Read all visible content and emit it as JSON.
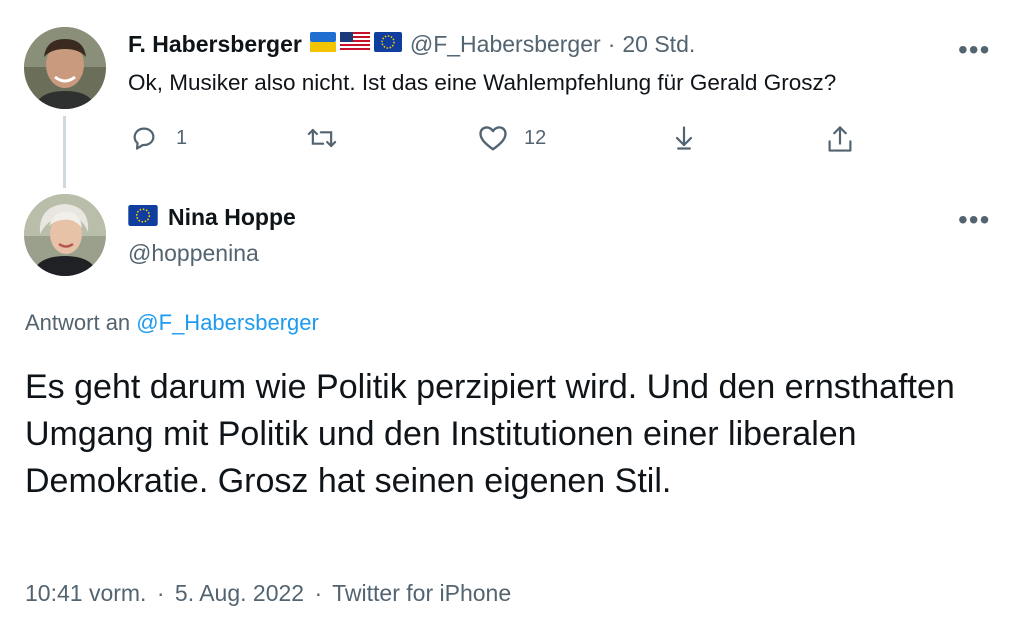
{
  "parent_tweet": {
    "display_name": "F. Habersberger",
    "flags": [
      "ukraine-flag-icon",
      "usa-flag-icon",
      "eu-flag-icon"
    ],
    "handle": "@F_Habersberger",
    "separator": "·",
    "time": "20 Std.",
    "text": "Ok, Musiker also nicht. Ist das eine Wahlempfehlung für Gerald Grosz?",
    "more": "•••",
    "actions": {
      "reply_count": "1",
      "retweet_count": "",
      "like_count": "12"
    }
  },
  "main_tweet": {
    "display_name": "Nina Hoppe",
    "flags": [
      "eu-flag-icon"
    ],
    "handle": "@hoppenina",
    "more": "•••",
    "reply_prefix": "Antwort an",
    "reply_mention": "@F_Habersberger",
    "text": "Es geht darum wie Politik perzipiert wird. Und den ernsthaften Umgang mit Politik und den Institutionen einer liberalen Demokratie. Grosz hat seinen eigenen Stil.",
    "meta": {
      "time": "10:41 vorm.",
      "date": "5. Aug. 2022",
      "source": "Twitter for iPhone",
      "separator": "·"
    }
  },
  "colors": {
    "text": "#0f1419",
    "secondary": "#536471",
    "link": "#1d9bf0",
    "thread_line": "#cfd9de"
  }
}
